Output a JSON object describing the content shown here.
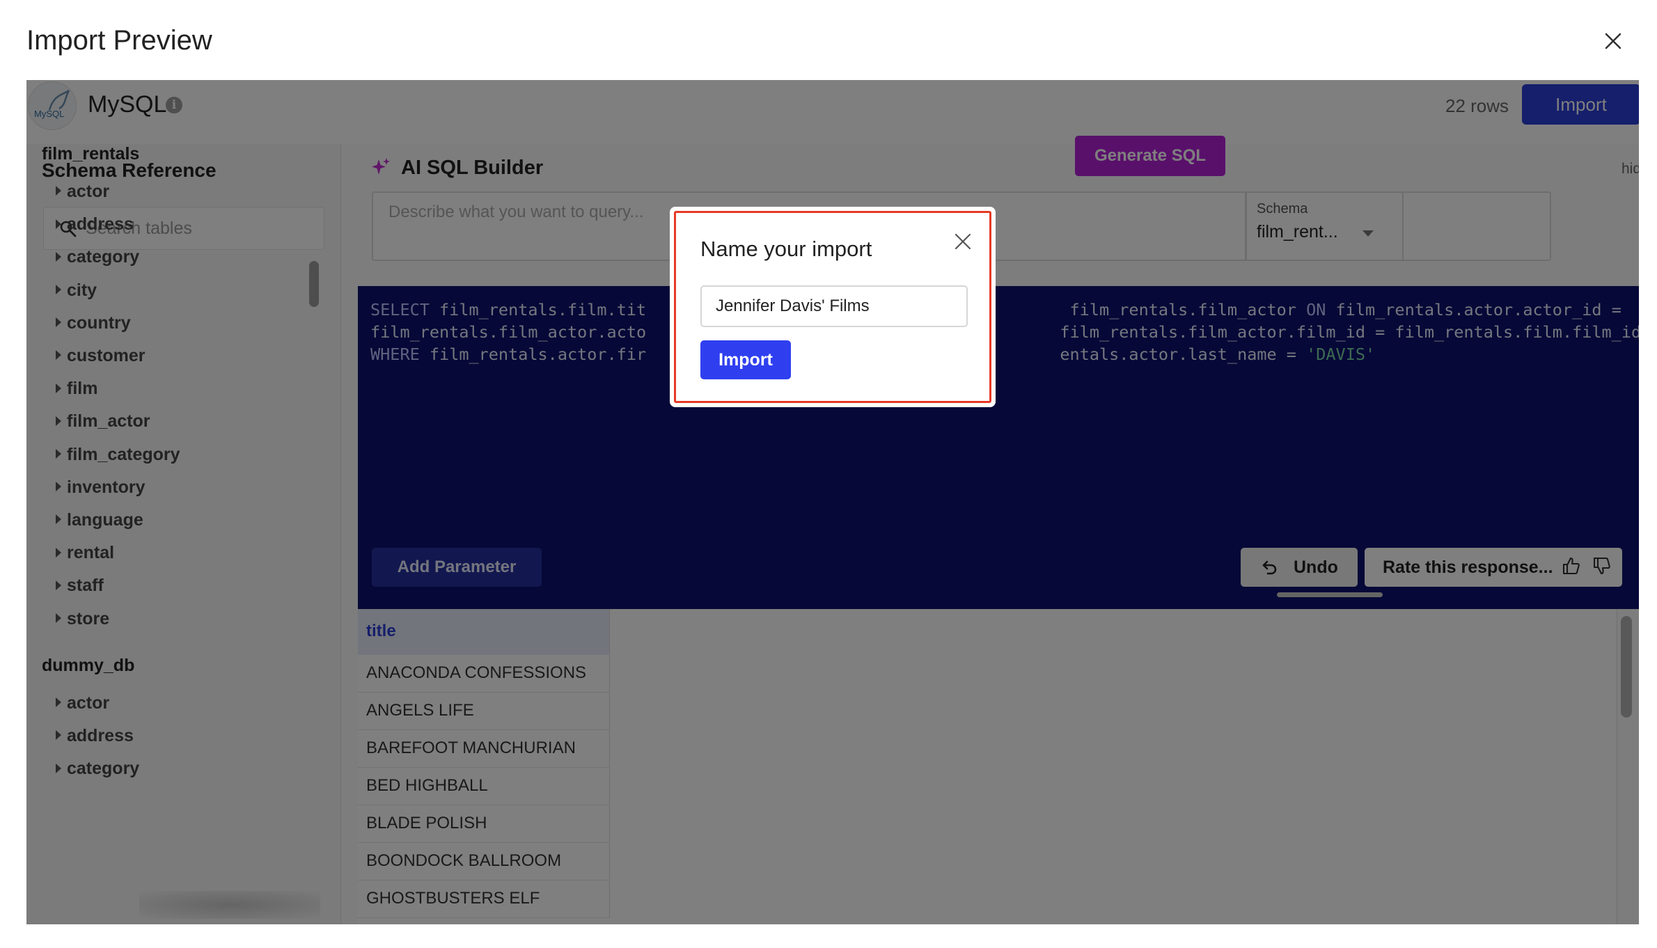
{
  "page": {
    "title": "Import Preview",
    "close_icon": "close-icon"
  },
  "connection": {
    "name": "MySQL",
    "logo_text": "MySQL",
    "info_icon": "i",
    "rows": "22 rows",
    "import_label": "Import"
  },
  "sidebar": {
    "title": "Schema Reference",
    "search_placeholder": "Search tables",
    "databases": [
      {
        "name": "film_rentals",
        "tables": [
          "actor",
          "address",
          "category",
          "city",
          "country",
          "customer",
          "film",
          "film_actor",
          "film_category",
          "inventory",
          "language",
          "rental",
          "staff",
          "store"
        ]
      },
      {
        "name": "dummy_db",
        "tables": [
          "actor",
          "address",
          "category"
        ]
      }
    ]
  },
  "ai_builder": {
    "title": "AI SQL Builder",
    "hide_label": "hide",
    "prompt_placeholder": "Describe what you want to query...",
    "schema_label": "Schema",
    "schema_value": "film_rent...",
    "generate_label": "Generate SQL"
  },
  "editor": {
    "sql_lines": [
      [
        [
          "kw",
          "SELECT"
        ],
        [
          "t",
          " film_rentals.film.tit"
        ],
        [
          "t",
          "                                           film_rentals.film_actor "
        ],
        [
          "kw",
          "ON"
        ],
        [
          "t",
          " film_rentals.actor.actor_id ="
        ]
      ],
      [
        [
          "t",
          "film_rentals.film_actor.acto"
        ],
        [
          "t",
          "                                          film_rentals.film_actor.film_id = film_rentals.film.film_id"
        ]
      ],
      [
        [
          "kw",
          "WHERE"
        ],
        [
          "t",
          " film_rentals.actor.fir"
        ],
        [
          "t",
          "                                          entals.actor.last_name = "
        ],
        [
          "str",
          "'DAVIS'"
        ]
      ]
    ],
    "add_parameter_label": "Add Parameter",
    "undo_label": "Undo",
    "rate_label": "Rate this response..."
  },
  "results": {
    "columns": [
      "title"
    ],
    "rows": [
      "ANACONDA CONFESSIONS",
      "ANGELS LIFE",
      "BAREFOOT MANCHURIAN",
      "BED HIGHBALL",
      "BLADE POLISH",
      "BOONDOCK BALLROOM",
      "GHOSTBUSTERS ELF"
    ]
  },
  "modal": {
    "title": "Name your import",
    "input_value": "Jennifer Davis' Films",
    "import_label": "Import"
  },
  "colors": {
    "accent": "#2c3fd6",
    "generate": "#b320d6",
    "editor_bg": "#0c106e",
    "focus_outline": "#e53a25"
  }
}
